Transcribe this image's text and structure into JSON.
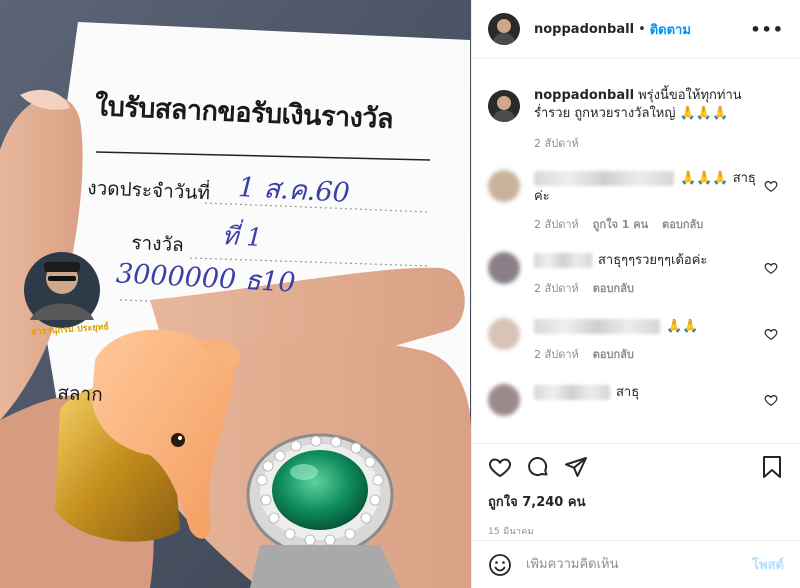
{
  "photo": {
    "ticket": {
      "title": "ใบรับสลากขอรับเงินรางวัล",
      "line1": "งวดประจำวันที่",
      "line2": "รางวัล",
      "line3": "สลาก"
    },
    "handwriting": {
      "date": "1 ส.ค.60",
      "prize": "ที่ 1",
      "amount": "3000000 ธ10"
    },
    "watermark": "สารานุกรม ประยุทธ์"
  },
  "header": {
    "username": "noppadonball",
    "dot": "•",
    "follow_label": "ติดตาม",
    "more_icon": "ellipsis-icon"
  },
  "caption": {
    "username": "noppadonball",
    "text": "พรุ่งนี้ขอให้ทุกท่านร่ำรวย ถูกหวยรางวัลใหญ่ 🙏🙏🙏",
    "time": "2 สัปดาห์"
  },
  "comments": [
    {
      "text": "🙏🙏🙏 สาธุค่ะ",
      "time": "2 สัปดาห์",
      "likes": "ถูกใจ 1 คน",
      "reply": "ตอบกลับ"
    },
    {
      "text": "สาธุๆๆรวยๆๆเด้อค่ะ",
      "time": "2 สัปดาห์",
      "likes": "",
      "reply": "ตอบกลับ"
    },
    {
      "text": "🙏🙏",
      "time": "2 สัปดาห์",
      "likes": "",
      "reply": "ตอบกลับ"
    },
    {
      "text": "สาธุ",
      "time": "",
      "likes": "",
      "reply": ""
    }
  ],
  "actions": {
    "likes": "ถูกใจ 7,240 คน",
    "date": "15 มีนาคม"
  },
  "add_comment": {
    "placeholder": "เพิ่มความคิดเห็น",
    "post_label": "โพสต์"
  },
  "colors": {
    "accent": "#0095f6",
    "post_disabled": "#b2dffc",
    "muted": "#8e8e8e",
    "border": "#efefef"
  }
}
